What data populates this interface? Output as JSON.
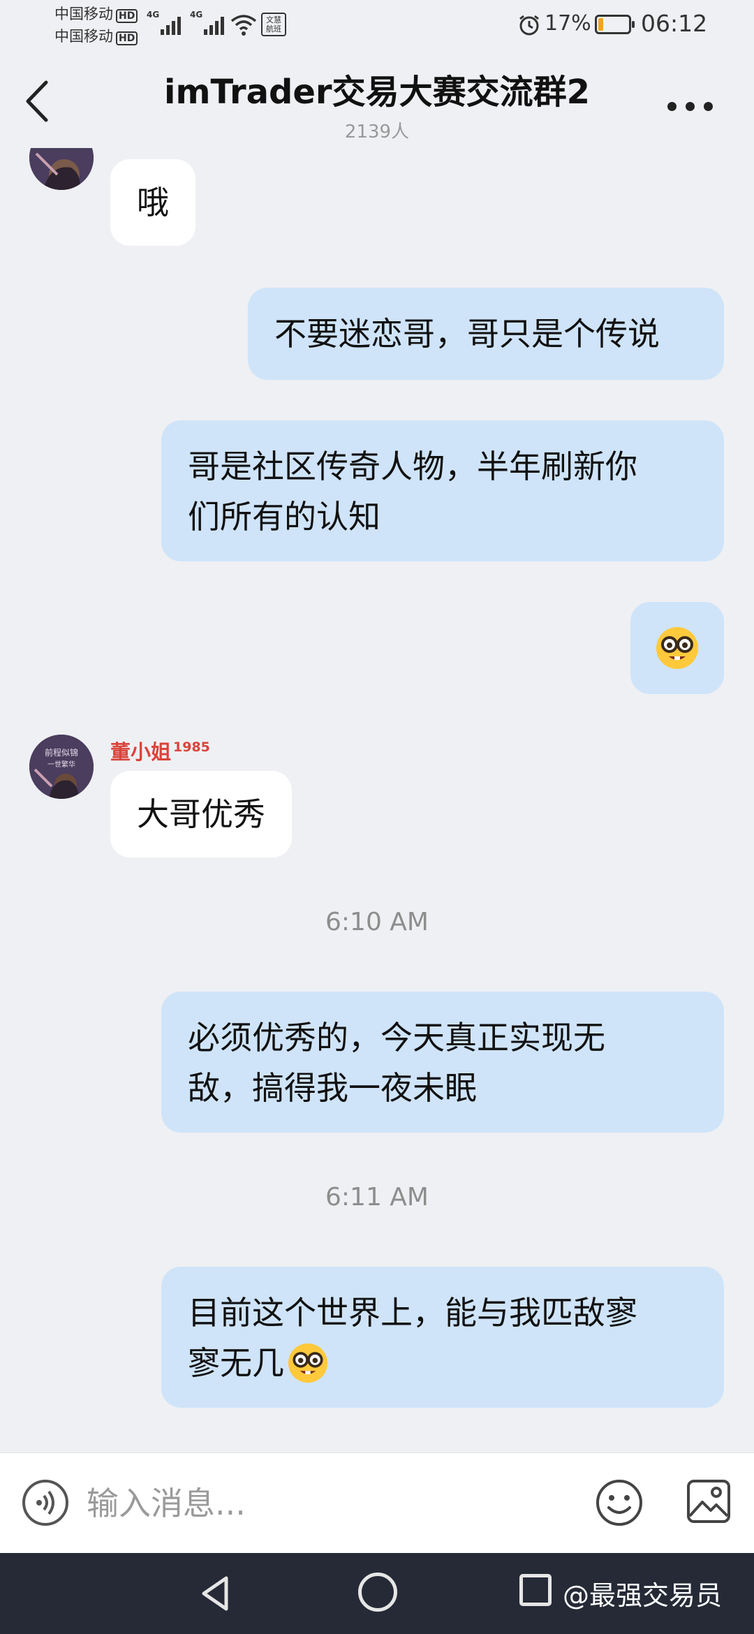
{
  "status_bar": {
    "carrier_1": "中国移动",
    "carrier_2": "中国移动",
    "hd_badge": "HD",
    "network_1": "4G",
    "network_2": "4G",
    "data_badge_line1": "文慧",
    "data_badge_line2": "航班",
    "battery_percent": "17%",
    "battery_level": 0.17,
    "battery_color": "#f2a222",
    "time": "06:12"
  },
  "header": {
    "back_icon": "chevron-left-icon",
    "title": "imTrader交易大赛交流群2",
    "member_count": "2139人",
    "more_icon": "more-horizontal-icon"
  },
  "messages": [
    {
      "direction": "in",
      "text": "哦"
    },
    {
      "direction": "out",
      "text": "不要迷恋哥，哥只是个传说"
    },
    {
      "direction": "out",
      "text_lines": [
        "哥是社区传奇人物，半年刷新你",
        "们所有的认知"
      ]
    },
    {
      "direction": "out",
      "emoji": "nerd-face-emoji"
    },
    {
      "direction": "in",
      "sender": "董小姐",
      "sender_level": "1985",
      "text": "大哥优秀"
    },
    {
      "timestamp": "6:10 AM"
    },
    {
      "direction": "out",
      "text_lines": [
        "必须优秀的，今天真正实现无",
        "敌，搞得我一夜未眠"
      ]
    },
    {
      "timestamp": "6:11 AM"
    },
    {
      "direction": "out",
      "text_lines": [
        "目前这个世界上，能与我匹敌寥",
        "寥无几"
      ],
      "trailing_emoji": "nerd-face-emoji"
    }
  ],
  "input_bar": {
    "placeholder": "输入消息...",
    "voice_icon": "voice-icon",
    "emoji_icon": "smiley-icon",
    "image_icon": "image-icon"
  },
  "nav_bar": {
    "back_icon": "triangle-back-icon",
    "home_icon": "circle-home-icon",
    "recent_icon": "square-recent-icon",
    "watermark": "@最强交易员"
  },
  "colors": {
    "background": "#eff0f3",
    "outgoing_bubble": "#cfe4f9",
    "incoming_bubble": "#ffffff",
    "sender_name": "#d9443b",
    "nav_bar": "#252a36"
  }
}
